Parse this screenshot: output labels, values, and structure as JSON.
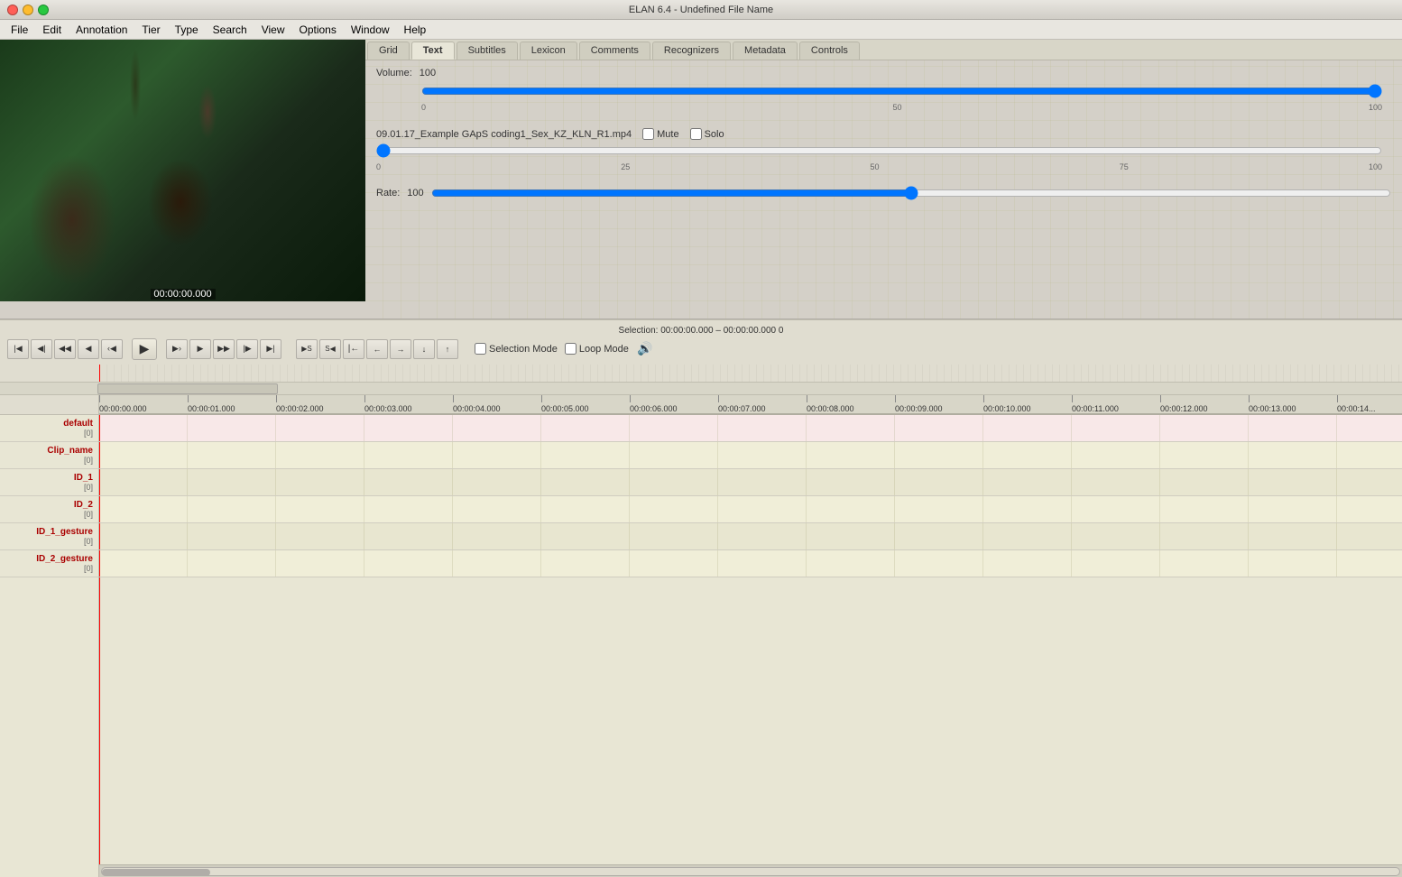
{
  "window": {
    "title": "ELAN 6.4 - Undefined File Name"
  },
  "menu": {
    "items": [
      "File",
      "Edit",
      "Annotation",
      "Tier",
      "Type",
      "Search",
      "View",
      "Options",
      "Window",
      "Help"
    ]
  },
  "tabs": {
    "items": [
      "Grid",
      "Text",
      "Subtitles",
      "Lexicon",
      "Comments",
      "Recognizers",
      "Metadata",
      "Controls"
    ],
    "active": "Controls"
  },
  "controls": {
    "volume_label": "Volume:",
    "volume_value": "100",
    "volume_slider_ticks": [
      "0",
      "50",
      "100"
    ],
    "media_filename": "09.01.17_Example GApS coding1_Sex_KZ_KLN_R1.mp4",
    "mute_label": "Mute",
    "solo_label": "Solo",
    "media_ticks": [
      "0",
      "25",
      "50",
      "75",
      "100"
    ],
    "rate_label": "Rate:",
    "rate_value": "100"
  },
  "transport": {
    "selection_label": "Selection: 00:00:00.000 – 00:00:00.000  0",
    "timestamp": "00:00:00.000",
    "selection_mode_label": "Selection Mode",
    "loop_mode_label": "Loop Mode"
  },
  "tracks": {
    "labels": [
      {
        "name": "default",
        "count": "[0]"
      },
      {
        "name": "Clip_name",
        "count": "[0]"
      },
      {
        "name": "ID_1",
        "count": "[0]"
      },
      {
        "name": "ID_2",
        "count": "[0]"
      },
      {
        "name": "ID_1_gesture",
        "count": "[0]"
      },
      {
        "name": "ID_2_gesture",
        "count": "[0]"
      }
    ],
    "time_marks": [
      "00:00:00.000",
      "00:00:01.000",
      "00:00:02.000",
      "00:00:03.000",
      "00:00:04.000",
      "00:00:05.000",
      "00:00:06.000",
      "00:00:07.000",
      "00:00:08.000",
      "00:00:09.000",
      "00:00:10.000",
      "00:00:11.000",
      "00:00:12.000",
      "00:00:13.000",
      "00:00:14..."
    ]
  }
}
